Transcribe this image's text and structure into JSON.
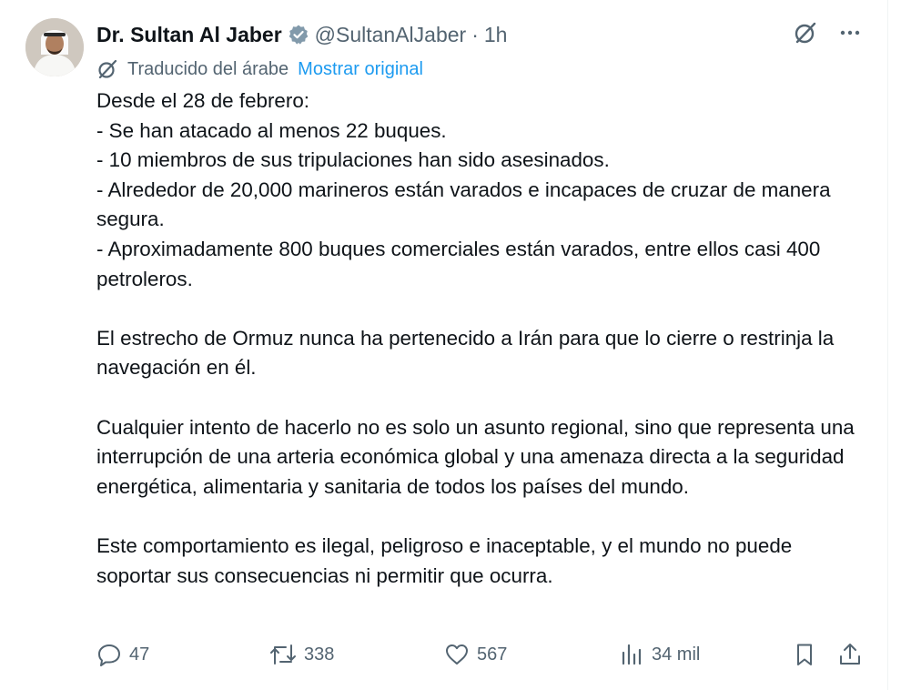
{
  "author": {
    "name": "Dr. Sultan Al Jaber",
    "handle": "@SultanAlJaber",
    "separator": "·",
    "time": "1h"
  },
  "translation": {
    "label": "Traducido del árabe",
    "show_original": "Mostrar original"
  },
  "body": {
    "p1": "Desde el 28 de febrero:",
    "p2": "- Se han atacado al menos 22 buques.",
    "p3": "- 10 miembros de sus tripulaciones han sido asesinados.",
    "p4": "- Alrededor de 20,000 marineros están varados e incapaces de cruzar de manera segura.",
    "p5": "- Aproximadamente 800 buques comerciales están varados, entre ellos casi 400 petroleros.",
    "p6": "El estrecho de Ormuz nunca ha pertenecido a Irán para que lo cierre o restrinja la navegación en él.",
    "p7": "Cualquier intento de hacerlo no es solo un asunto regional, sino que representa una interrupción de una arteria económica global y una amenaza directa a la seguridad energética, alimentaria y sanitaria de todos los países del mundo.",
    "p8": "Este comportamiento es ilegal, peligroso e inaceptable, y el mundo no puede soportar sus consecuencias ni permitir que ocurra."
  },
  "actions": {
    "replies": "47",
    "reposts": "338",
    "likes": "567",
    "views": "34 mil"
  },
  "icons": {
    "verified": "verified-badge-icon",
    "translate": "grok-translate-icon",
    "more": "more-icon",
    "reply": "reply-icon",
    "repost": "repost-icon",
    "like": "heart-icon",
    "views": "bar-chart-icon",
    "bookmark": "bookmark-icon",
    "share": "share-icon"
  },
  "colors": {
    "text": "#0f1419",
    "secondary": "#536471",
    "accent": "#1d9bf0",
    "verified": "#829aab"
  }
}
